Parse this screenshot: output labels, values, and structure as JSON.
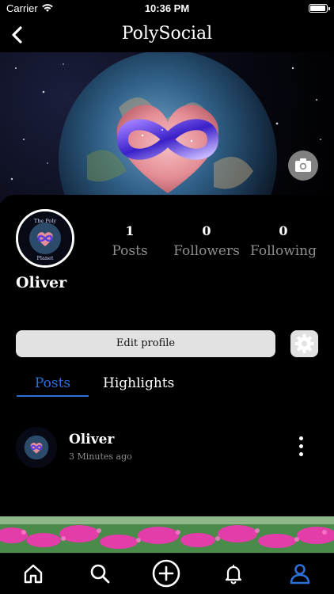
{
  "status_bar": {
    "carrier": "Carrier",
    "time": "10:36 PM"
  },
  "nav": {
    "title": "PolySocial"
  },
  "profile": {
    "name": "Oliver",
    "avatar_text_top": "The Poly",
    "avatar_text_bottom": "Planet",
    "stats": [
      {
        "value": "1",
        "label": "Posts"
      },
      {
        "value": "0",
        "label": "Followers"
      },
      {
        "value": "0",
        "label": "Following"
      }
    ],
    "edit_label": "Edit profile"
  },
  "tabs": {
    "posts": "Posts",
    "highlights": "Highlights"
  },
  "post": {
    "author": "Oliver",
    "time": "3 Minutes ago"
  },
  "icons": {
    "back": "chevron-left-icon",
    "camera": "camera-icon",
    "settings": "gear-icon",
    "more": "vertical-dots-icon",
    "home": "home-icon",
    "search": "search-icon",
    "add": "plus-circle-icon",
    "notifications": "bell-icon",
    "profile": "person-icon"
  },
  "colors": {
    "accent": "#2d6fd8",
    "muted": "#8e8e8e",
    "button": "#e2e2e2"
  }
}
